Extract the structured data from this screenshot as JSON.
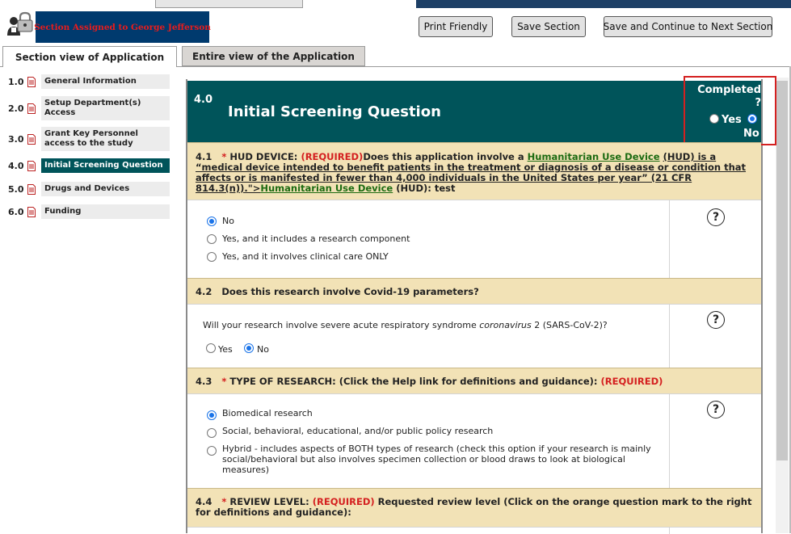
{
  "assignment": {
    "banner": "Section Assigned to George Jefferson",
    "icon": "lock-user-icon"
  },
  "toolbar": {
    "print": "Print Friendly",
    "save": "Save Section",
    "save_continue": "Save and Continue to Next Section"
  },
  "tabs": {
    "section_view": "Section view of Application",
    "entire_view": "Entire view of the Application"
  },
  "sidebar": {
    "items": [
      {
        "num": "1.0",
        "label": "General Information"
      },
      {
        "num": "2.0",
        "label": "Setup Department(s) Access"
      },
      {
        "num": "3.0",
        "label": "Grant Key Personnel access to the study"
      },
      {
        "num": "4.0",
        "label": "Initial Screening Question"
      },
      {
        "num": "5.0",
        "label": "Drugs and Devices"
      },
      {
        "num": "6.0",
        "label": "Funding"
      }
    ],
    "active_index": 3,
    "item_icon": "document-icon"
  },
  "section": {
    "number": "4.0",
    "title": "Initial Screening Question",
    "completed_label": "Completed ?",
    "yes": "Yes",
    "no": "No",
    "selected": "No"
  },
  "questions": {
    "q1": {
      "number": "4.1",
      "star": "*",
      "lead": "HUD DEVICE:",
      "required": "(REQUIRED)",
      "text_a": "Does this application involve a",
      "link_a": "Humanitarian Use Device",
      "text_b": "(HUD) is a “medical device intended to benefit patients in the treatment or diagnosis of a disease or condition that affects or is manifested in fewer than 4,000 individuals in the United States per year” (21 CFR 814.3(n)).\">",
      "link_b": "Humanitarian Use Device",
      "text_c": "(HUD): test",
      "options": [
        "No",
        "Yes, and it includes a research component",
        "Yes, and it involves clinical care ONLY"
      ],
      "selected": "No"
    },
    "q2": {
      "number": "4.2",
      "text": "Does this research involve Covid-19 parameters?",
      "prompt_a": "Will your research involve severe acute respiratory syndrome",
      "prompt_italic": "coronavirus",
      "prompt_b": "2 (SARS-CoV-2)?",
      "options": [
        "Yes",
        "No"
      ],
      "selected": "No"
    },
    "q3": {
      "number": "4.3",
      "star": "*",
      "text": "TYPE OF RESEARCH: (Click the Help link for definitions and guidance):",
      "required": "(REQUIRED)",
      "options": [
        "Biomedical research",
        "Social, behavioral, educational, and/or public policy research",
        "Hybrid - includes aspects of BOTH types of research (check this option if your research is mainly social/behavioral but also involves specimen collection or blood draws to look at biological measures)"
      ],
      "selected": "Biomedical research"
    },
    "q4": {
      "number": "4.4",
      "star": "*",
      "lead": "REVIEW LEVEL:",
      "required": "(REQUIRED)",
      "text": "Requested review level (Click on the orange question mark to the right for definitions and guidance):"
    }
  },
  "help": {
    "glyph": "?",
    "icon": "help-question-icon"
  }
}
